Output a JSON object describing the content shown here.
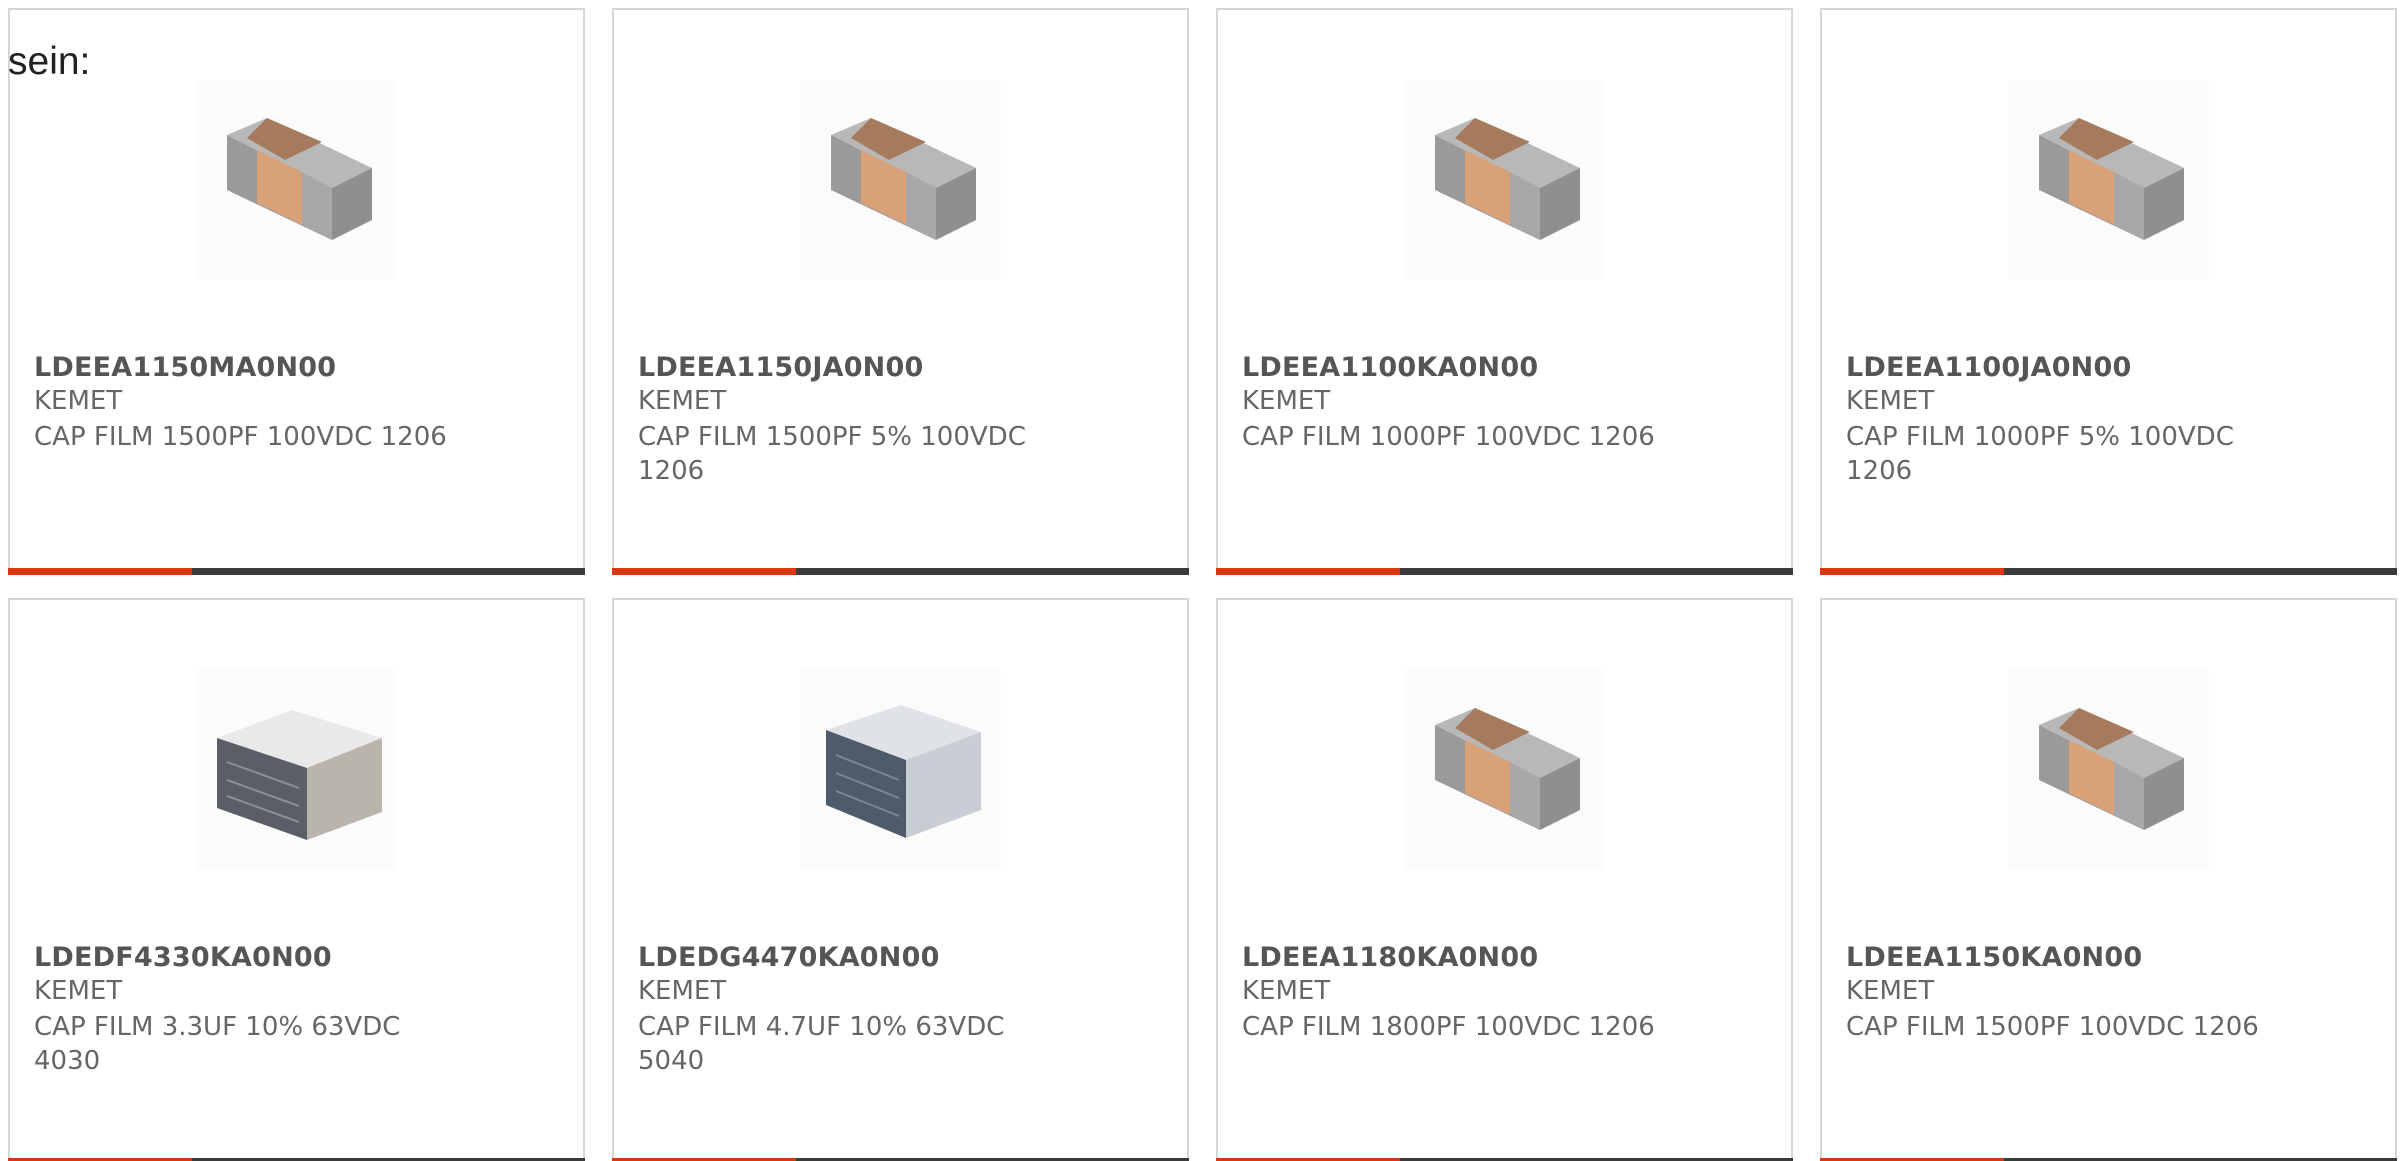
{
  "intro_text": "sein:",
  "products": [
    {
      "part_number": "LDEEA1150MA0N00",
      "manufacturer": "KEMET",
      "description": "CAP FILM 1500PF 100VDC 1206",
      "image": "smd-chip-capacitor-icon"
    },
    {
      "part_number": "LDEEA1150JA0N00",
      "manufacturer": "KEMET",
      "description": "CAP FILM 1500PF 5% 100VDC 1206",
      "image": "smd-chip-capacitor-icon"
    },
    {
      "part_number": "LDEEA1100KA0N00",
      "manufacturer": "KEMET",
      "description": "CAP FILM 1000PF 100VDC 1206",
      "image": "smd-chip-capacitor-icon"
    },
    {
      "part_number": "LDEEA1100JA0N00",
      "manufacturer": "KEMET",
      "description": "CAP FILM 1000PF 5% 100VDC 1206",
      "image": "smd-chip-capacitor-icon"
    },
    {
      "part_number": "LDEDF4330KA0N00",
      "manufacturer": "KEMET",
      "description": "CAP FILM 3.3UF 10% 63VDC 4030",
      "image": "film-capacitor-block-icon"
    },
    {
      "part_number": "LDEDG4470KA0N00",
      "manufacturer": "KEMET",
      "description": "CAP FILM 4.7UF 10% 63VDC 5040",
      "image": "film-capacitor-block-icon"
    },
    {
      "part_number": "LDEEA1180KA0N00",
      "manufacturer": "KEMET",
      "description": "CAP FILM 1800PF 100VDC 1206",
      "image": "smd-chip-capacitor-icon"
    },
    {
      "part_number": "LDEEA1150KA0N00",
      "manufacturer": "KEMET",
      "description": "CAP FILM 1500PF 100VDC 1206",
      "image": "smd-chip-capacitor-icon"
    }
  ],
  "colors": {
    "accent_bar": "#d8380e",
    "dark_bar": "#3b3b3b",
    "card_border": "#d6d6d6"
  }
}
